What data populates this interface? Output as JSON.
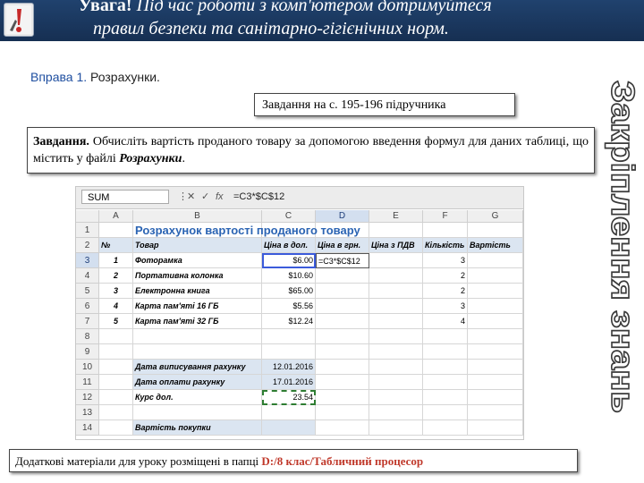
{
  "banner": {
    "warning_label": "Увага!",
    "warning_line1": "Під час роботи з комп'ютером дотримуйтеся",
    "warning_line2": "правил безпеки та санітарно-гігієнічних норм."
  },
  "exercise": {
    "prefix": "Вправа",
    "number": "1.",
    "title": "Розрахунки."
  },
  "side_title": "Закріплення знань",
  "task_ref": "Завдання на с. 195-196 підручника",
  "task": {
    "label": "Завдання.",
    "text": "Обчисліть вартість проданого товару за допомогою введення формул для даних таблиці, що містить у файлі",
    "file": "Розрахунки",
    "end": "."
  },
  "spreadsheet": {
    "name_box": "SUM",
    "fx": "fx",
    "formula": "=C3*$C$12",
    "columns": [
      "A",
      "B",
      "C",
      "D",
      "E",
      "F",
      "G"
    ],
    "rows": [
      "1",
      "2",
      "3",
      "4",
      "5",
      "6",
      "7",
      "8",
      "9",
      "10",
      "11",
      "12",
      "13",
      "14"
    ],
    "selected_column": "D",
    "selected_row": "3",
    "title": "Розрахунок вартості проданого товару",
    "headers": [
      "№",
      "Товар",
      "Ціна в дол.",
      "Ціна в грн.",
      "Ціна з ПДВ",
      "Кількість",
      "Вартість"
    ],
    "items": [
      {
        "n": "1",
        "product": "Фоторамка",
        "price": "$6.00",
        "qty": "3"
      },
      {
        "n": "2",
        "product": "Портативна колонка",
        "price": "$10.60",
        "qty": "2"
      },
      {
        "n": "3",
        "product": "Електронна книга",
        "price": "$65.00",
        "qty": "2"
      },
      {
        "n": "4",
        "product": "Карта пам'яті 16 ГБ",
        "price": "$5.56",
        "qty": "3"
      },
      {
        "n": "5",
        "product": "Карта пам'яті 32 ГБ",
        "price": "$12.24",
        "qty": "4"
      }
    ],
    "editing_cell_text": "=C3*$C$12",
    "date_issue_label": "Дата виписування рахунку",
    "date_issue": "12.01.2016",
    "date_pay_label": "Дата оплати рахунку",
    "date_pay": "17.01.2016",
    "rate_label": "Курс дол.",
    "rate": "23.54",
    "total_label": "Вартість покупки"
  },
  "footer": {
    "text": "Додаткові матеріали для уроку розміщені в папці",
    "path": "D:/8 клас/Табличний процесор"
  },
  "colors": {
    "banner": "#1c3a63",
    "sheet_title": "#2b64b3",
    "footer_path": "#c0392b",
    "label_fill": "#dbe5f1"
  }
}
